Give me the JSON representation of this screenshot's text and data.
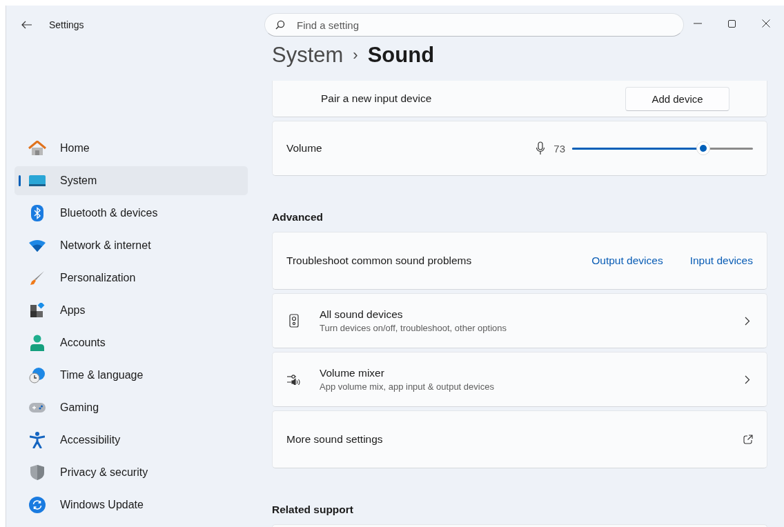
{
  "window": {
    "title": "Settings"
  },
  "search": {
    "placeholder": "Find a setting"
  },
  "sidebar": {
    "items": [
      {
        "label": "Home",
        "selected": false
      },
      {
        "label": "System",
        "selected": true
      },
      {
        "label": "Bluetooth & devices",
        "selected": false
      },
      {
        "label": "Network & internet",
        "selected": false
      },
      {
        "label": "Personalization",
        "selected": false
      },
      {
        "label": "Apps",
        "selected": false
      },
      {
        "label": "Accounts",
        "selected": false
      },
      {
        "label": "Time & language",
        "selected": false
      },
      {
        "label": "Gaming",
        "selected": false
      },
      {
        "label": "Accessibility",
        "selected": false
      },
      {
        "label": "Privacy & security",
        "selected": false
      },
      {
        "label": "Windows Update",
        "selected": false
      }
    ]
  },
  "breadcrumb": {
    "parent": "System",
    "separator": "›",
    "current": "Sound"
  },
  "top_cards": [
    {
      "kind": "button",
      "label": "Pair a new input device",
      "button": "Add device"
    },
    {
      "kind": "slider",
      "label": "Volume",
      "reading": "73",
      "level": 0.73
    }
  ],
  "sections": [
    {
      "heading": "Advanced",
      "cards": [
        {
          "kind": "links",
          "label": "Troubleshoot common sound problems",
          "links": [
            "Output devices",
            "Input devices"
          ]
        },
        {
          "kind": "nav",
          "label": "All sound devices",
          "description": "Turn devices on/off, troubleshoot, other options"
        },
        {
          "kind": "nav",
          "label": "Volume mixer",
          "description": "App volume mix, app input & output devices"
        },
        {
          "kind": "external",
          "label": "More sound settings"
        }
      ]
    },
    {
      "heading": "Related support",
      "cards": [
        {
          "kind": "empty"
        }
      ]
    }
  ]
}
